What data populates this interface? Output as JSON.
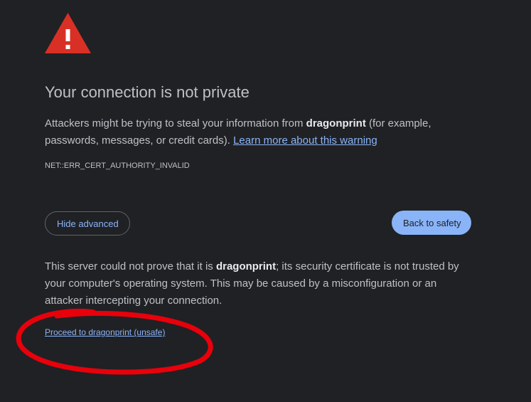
{
  "heading": {
    "title": "Your connection is not private"
  },
  "description": {
    "prefix": "Attackers might be trying to steal your information from ",
    "host": "dragonprint",
    "suffix": " (for example, passwords, messages, or credit cards). ",
    "learn_more": "Learn more about this warning"
  },
  "error_code": "NET::ERR_CERT_AUTHORITY_INVALID",
  "buttons": {
    "hide_advanced": "Hide advanced",
    "back_to_safety": "Back to safety"
  },
  "details": {
    "prefix": "This server could not prove that it is ",
    "host": "dragonprint",
    "suffix": "; its security certificate is not trusted by your computer's operating system. This may be caused by a misconfiguration or an attacker intercepting your connection."
  },
  "proceed_link": "Proceed to dragonprint (unsafe)",
  "colors": {
    "background": "#202124",
    "warning_red": "#d93025",
    "link_blue": "#8ab4f8",
    "annotation_red": "#e8000b"
  },
  "icons": {
    "warning": "warning-triangle-icon"
  }
}
